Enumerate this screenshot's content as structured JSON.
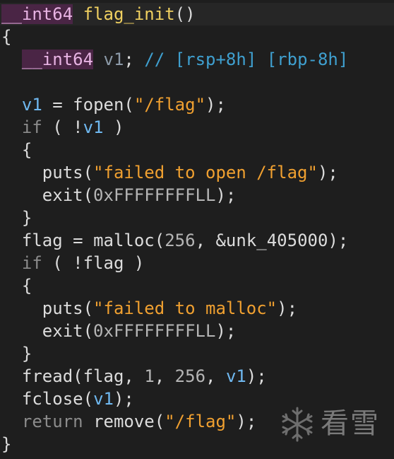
{
  "code": {
    "l1": {
      "type": "__int64",
      "name": "flag_init",
      "rest": "()"
    },
    "l2": "{",
    "l3": {
      "type": "__int64",
      "var": "v1",
      "semi": ";",
      "comment": "// [rsp+8h] [rbp-8h]"
    },
    "l5": {
      "var": "v1",
      "eq": " = ",
      "fn": "fopen",
      "open": "(",
      "str": "\"/flag\"",
      "close": ");"
    },
    "l6": {
      "kw": "if",
      "p1": " ( !",
      "var": "v1",
      "p2": " )"
    },
    "l7": "{",
    "l8": {
      "fn": "puts",
      "open": "(",
      "str": "\"failed to open /flag\"",
      "close": ");"
    },
    "l9": {
      "fn": "exit",
      "open": "(",
      "num": "0xFFFFFFFFLL",
      "close": ");"
    },
    "l10": "}",
    "l11": {
      "lhs": "flag",
      "eq": " = ",
      "fn": "malloc",
      "open": "(",
      "num": "256",
      "sep": ", ",
      "arg": "&unk_405000",
      "close": ");"
    },
    "l12": {
      "kw": "if",
      "p1": " ( !",
      "var": "flag",
      "p2": " )"
    },
    "l13": "{",
    "l14": {
      "fn": "puts",
      "open": "(",
      "str": "\"failed to malloc\"",
      "close": ");"
    },
    "l15": {
      "fn": "exit",
      "open": "(",
      "num": "0xFFFFFFFFLL",
      "close": ");"
    },
    "l16": "}",
    "l17": {
      "fn": "fread",
      "open": "(",
      "a1": "flag",
      "s1": ", ",
      "n1": "1",
      "s2": ", ",
      "n2": "256",
      "s3": ", ",
      "var": "v1",
      "close": ");"
    },
    "l18": {
      "fn": "fclose",
      "open": "(",
      "var": "v1",
      "close": ");"
    },
    "l19": {
      "kw": "return",
      "sp": " ",
      "fn": "remove",
      "open": "(",
      "str": "\"/flag\"",
      "close": ");"
    },
    "l20": "}"
  },
  "watermark": {
    "text": "看雪",
    "icon": "snowflake-icon"
  },
  "colors": {
    "background": "#1e1e1e",
    "string": "#f0a030",
    "variable": "#6fb8f0",
    "type_highlight": "#4a2545",
    "comment": "#3fa0d0"
  }
}
